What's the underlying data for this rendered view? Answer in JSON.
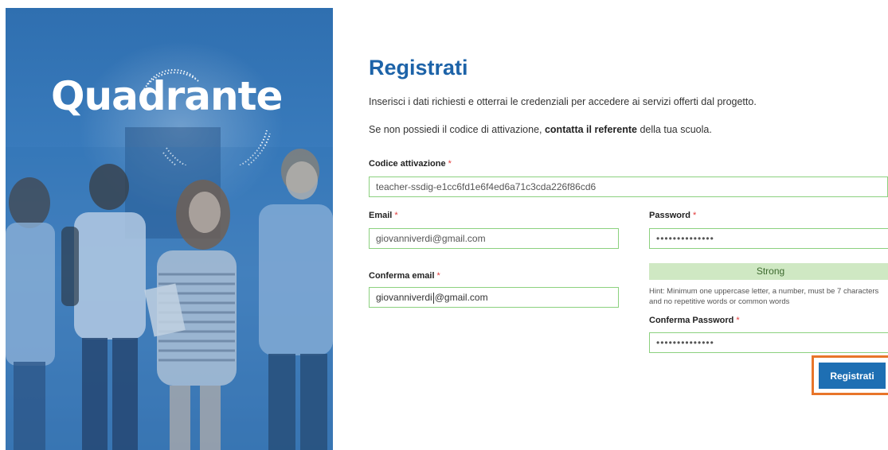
{
  "brand": {
    "logo_text": "Quadrante"
  },
  "form": {
    "title": "Registrati",
    "intro_line1": "Inserisci i dati richiesti e otterrai le credenziali per accedere ai servizi offerti dal progetto.",
    "intro_line2_pre": "Se non possiedi il codice di attivazione, ",
    "intro_line2_bold": "contatta il referente",
    "intro_line2_post": " della tua scuola.",
    "required_mark": "*",
    "activation_code": {
      "label": "Codice attivazione",
      "value": "teacher-ssdig-e1cc6fd1e6f4ed6a71c3cda226f86cd6"
    },
    "email": {
      "label": "Email",
      "value": "giovanniverdi@gmail.com"
    },
    "confirm_email": {
      "label": "Conferma email",
      "value_before_caret": "giovanniverdi",
      "value_after_caret": "@gmail.com"
    },
    "password": {
      "label": "Password",
      "value_masked": "••••••••••••••"
    },
    "password_strength": "Strong",
    "password_hint": "Hint: Minimum one uppercase letter, a number, must be 7 characters and no repetitive words or common words",
    "confirm_password": {
      "label": "Conferma Password",
      "value_masked": "••••••••••••••"
    },
    "submit_label": "Registrati"
  },
  "colors": {
    "accent": "#1d63a8",
    "button": "#1e6fb3",
    "valid_border": "#8cd17f",
    "strength_bg": "#cfe8c3",
    "highlight": "#e8752a",
    "required": "#e23b3b"
  }
}
